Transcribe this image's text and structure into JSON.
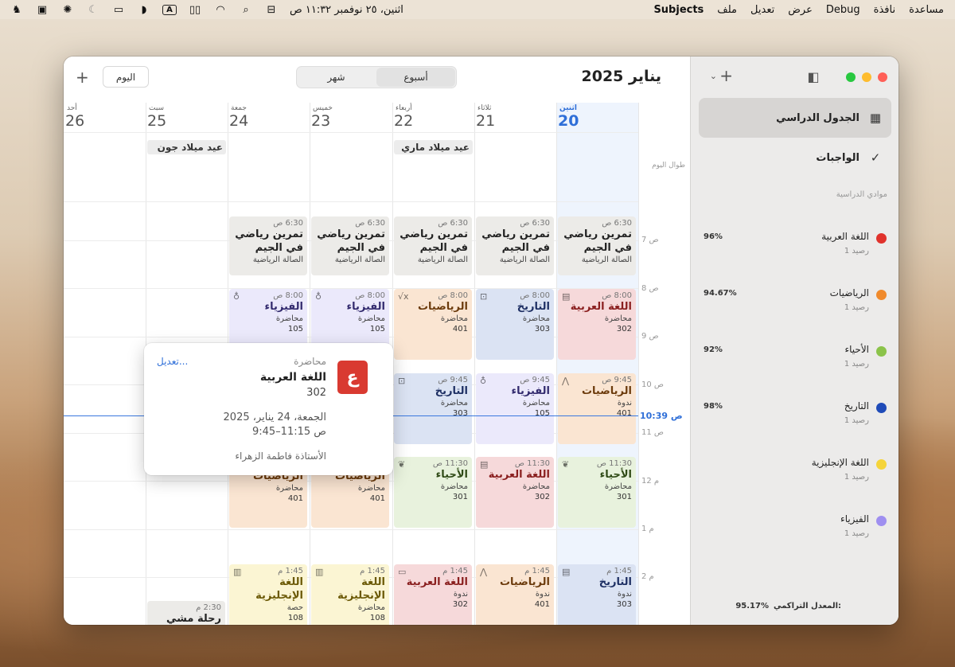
{
  "menubar": {
    "apple": "",
    "app": "Subjects",
    "menus": [
      "ملف",
      "تعديل",
      "عرض",
      "Debug",
      "نافذة",
      "مساعدة"
    ],
    "datetime": "اثنين، ٢٥ نوفمبر ١١:٣٢ ص"
  },
  "header": {
    "add_symbol": "+",
    "today": "اليوم",
    "view_week": "أسبوع",
    "view_month": "شهر",
    "title": "يناير 2025"
  },
  "days": [
    {
      "name": "اثنين",
      "num": "20"
    },
    {
      "name": "ثلاثاء",
      "num": "21"
    },
    {
      "name": "أربعاء",
      "num": "22"
    },
    {
      "name": "خميس",
      "num": "23"
    },
    {
      "name": "جمعة",
      "num": "24"
    },
    {
      "name": "سبت",
      "num": "25"
    },
    {
      "name": "أحد",
      "num": "26"
    }
  ],
  "allday": {
    "label": "طوال اليوم",
    "events": [
      "عيد ميلاد ماري",
      "عيد ميلاد جون"
    ]
  },
  "hours": [
    "7 ص",
    "8 ص",
    "9 ص",
    "10 ص",
    "11 ص",
    "12 م",
    "1 م",
    "2 م"
  ],
  "now_label": "10:39 ص",
  "events": {
    "gym": {
      "time": "6:30 ص",
      "title": "تمرين رياضي في الجيم",
      "place": "الصالة الرياضية"
    },
    "mon_arab": {
      "time": "8:00 ص",
      "title": "اللغة العربية",
      "type": "محاضرة",
      "room": "302"
    },
    "tue_hist": {
      "time": "8:00 ص",
      "title": "التاريخ",
      "type": "محاضرة",
      "room": "303"
    },
    "wed_math": {
      "time": "8:00 ص",
      "title": "الرياضيات",
      "type": "محاضرة",
      "room": "401"
    },
    "thu_phy": {
      "time": "8:00 ص",
      "title": "الفيزياء",
      "type": "محاضرة",
      "room": "105"
    },
    "fri_phy": {
      "time": "8:00 ص",
      "title": "الفيزياء",
      "type": "محاضرة",
      "room": "105"
    },
    "mon_math": {
      "time": "9:45 ص",
      "title": "الرياضيات",
      "type": "ندوة",
      "room": "401"
    },
    "tue_phy": {
      "time": "9:45 ص",
      "title": "الفيزياء",
      "type": "محاضرة",
      "room": "105"
    },
    "wed_hist": {
      "time": "9:45 ص",
      "title": "التاريخ",
      "type": "محاضرة",
      "room": "303"
    },
    "mon_bio": {
      "time": "11:30 ص",
      "title": "الأحياء",
      "type": "محاضرة",
      "room": "301"
    },
    "tue_arab": {
      "time": "11:30 ص",
      "title": "اللغة العربية",
      "type": "محاضرة",
      "room": "302"
    },
    "wed_bio": {
      "time": "11:30 ص",
      "title": "الأحياء",
      "type": "محاضرة",
      "room": "301"
    },
    "thu_math": {
      "title": "الرياضيات",
      "type": "محاضرة",
      "room": "401"
    },
    "fri_math": {
      "title": "الرياضيات",
      "type": "محاضرة",
      "room": "401"
    },
    "mon_hist": {
      "time": "1:45 م",
      "title": "التاريخ",
      "type": "ندوة",
      "room": "303"
    },
    "tue_math": {
      "time": "1:45 م",
      "title": "الرياضيات",
      "type": "ندوة",
      "room": "401"
    },
    "wed_arab": {
      "time": "1:45 م",
      "title": "اللغة العربية",
      "type": "ندوة",
      "room": "302"
    },
    "thu_eng": {
      "time": "1:45 م",
      "title": "اللغة الإنجليزية",
      "type": "محاضرة",
      "room": "108"
    },
    "fri_eng": {
      "time": "1:45 م",
      "title": "اللغة الإنجليزية",
      "type": "حصة",
      "room": "108"
    },
    "sat_trip": {
      "time": "2:30 م",
      "title": "رحلة مشي"
    }
  },
  "popover": {
    "icon_letter": "ع",
    "type": "محاضرة",
    "title": "اللغة العربية",
    "room": "302",
    "edit": "تعديل...",
    "date": "الجمعة، 24 يناير، 2025",
    "time": "9:45–11:15 ص",
    "teacher": "الأستاذة فاطمة الزهراء"
  },
  "sidebar": {
    "nav": [
      {
        "label": "الجدول الدراسي",
        "icon": "calendar-icon"
      },
      {
        "label": "الواجبات",
        "icon": "checkmark-circle-icon"
      }
    ],
    "section_heading": "موادي الدراسية",
    "subjects": [
      {
        "name": "اللغة العربية",
        "count": "1 رصيد",
        "pct": "96%",
        "color": "#e0322c"
      },
      {
        "name": "الرياضيات",
        "count": "1 رصيد",
        "pct": "94.67%",
        "color": "#f08a2c"
      },
      {
        "name": "الأحياء",
        "count": "1 رصيد",
        "pct": "92%",
        "color": "#8bc34a"
      },
      {
        "name": "التاريخ",
        "count": "1 رصيد",
        "pct": "98%",
        "color": "#1f4bb8"
      },
      {
        "name": "اللغة الإنجليزية",
        "count": "1 رصيد",
        "pct": "",
        "color": "#f5d43a"
      },
      {
        "name": "الفيزياء",
        "count": "1 رصيد",
        "pct": "",
        "color": "#9f8ff0"
      }
    ],
    "gpa_label": "المعدل التراكمي:",
    "gpa_value": "95.17%"
  }
}
